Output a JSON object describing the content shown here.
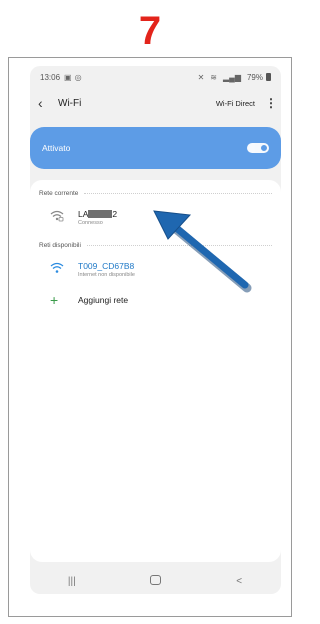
{
  "step_number": "7",
  "status_bar": {
    "time": "13:06",
    "left_icons": [
      "gallery-icon",
      "instagram-icon"
    ],
    "right_icons": [
      "mute-icon",
      "vibrate-icon",
      "signal-icon"
    ],
    "battery": "79%"
  },
  "app_bar": {
    "back_icon": "chevron-left-icon",
    "title": "Wi-Fi",
    "wifi_direct": "Wi-Fi Direct",
    "more_icon": "more-vertical-icon"
  },
  "toggle": {
    "label": "Attivato",
    "state": "on"
  },
  "current_section": {
    "header": "Rete corrente",
    "network": {
      "name_prefix": "LA",
      "name_suffix": "2",
      "status": "Connesso",
      "icon": "wifi-lock-icon"
    }
  },
  "available_section": {
    "header": "Reti disponibili",
    "networks": [
      {
        "name": "T009_CD67B8",
        "status": "Internet non disponibile",
        "icon": "wifi-icon"
      }
    ],
    "add_label": "Aggiungi rete"
  },
  "nav_bar": {
    "recent_label": "|||",
    "back_label": "<"
  },
  "colors": {
    "accent": "#5d9ce6",
    "step_red": "#e3241b",
    "arrow_blue": "#1f67b0",
    "link_blue": "#1f79c7",
    "add_green": "#3a9b4a"
  }
}
